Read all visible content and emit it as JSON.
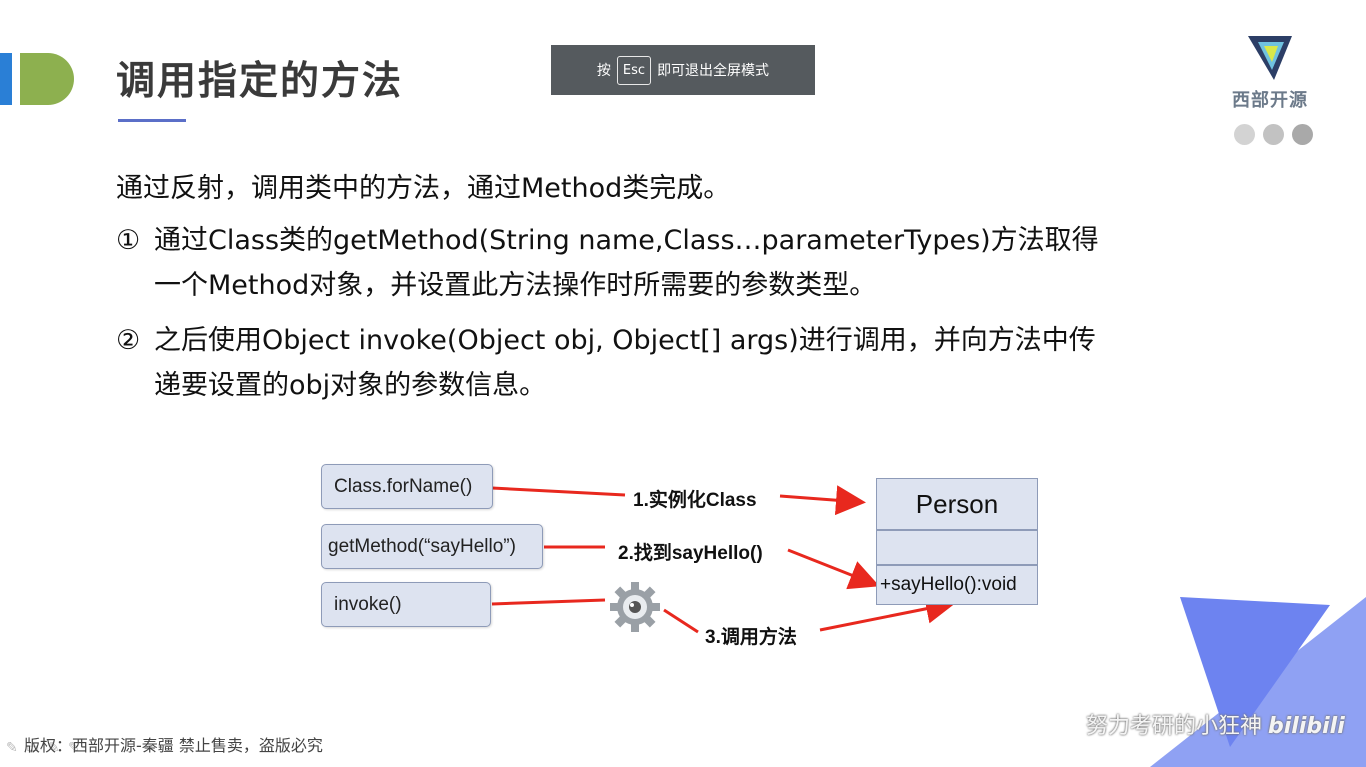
{
  "slide": {
    "title": "调用指定的方法",
    "intro": "通过反射，调用类中的方法，通过Method类完成。",
    "items": [
      {
        "marker": "①",
        "line1": "通过Class类的getMethod(String name,Class…parameterTypes)方法取得",
        "line2": "一个Method对象，并设置此方法操作时所需要的参数类型。"
      },
      {
        "marker": "②",
        "line1": "之后使用Object invoke(Object obj, Object[] args)进行调用，并向方法中传",
        "line2": "递要设置的obj对象的参数信息。"
      }
    ],
    "copyright": "版权：西部开源-秦疆     禁止售卖，盗版必究"
  },
  "toast": {
    "prefix": "按",
    "key": "Esc",
    "suffix": "即可退出全屏模式"
  },
  "logo": {
    "text": "西部开源"
  },
  "diagram": {
    "nodes": {
      "forname": "Class.forName()",
      "getmethod": "getMethod(“sayHello”)",
      "invoke": "invoke()"
    },
    "class_box": {
      "name": "Person",
      "method": "+sayHello():void"
    },
    "labels": {
      "step1": "1.实例化Class",
      "step2": "2.找到sayHello()",
      "step3": "3.调用方法"
    }
  },
  "watermark": {
    "text": "努力考研的小狂神",
    "brand": "bilibili"
  },
  "colors": {
    "accent_blue": "#2a7fd6",
    "accent_green": "#8db04f",
    "arrow_red": "#e8281e",
    "node_fill": "#dde3f0",
    "triangle_blue": "#6d83f0"
  },
  "icons": [
    "gear-icon",
    "logo-mark-icon",
    "pen-tool-icon"
  ]
}
